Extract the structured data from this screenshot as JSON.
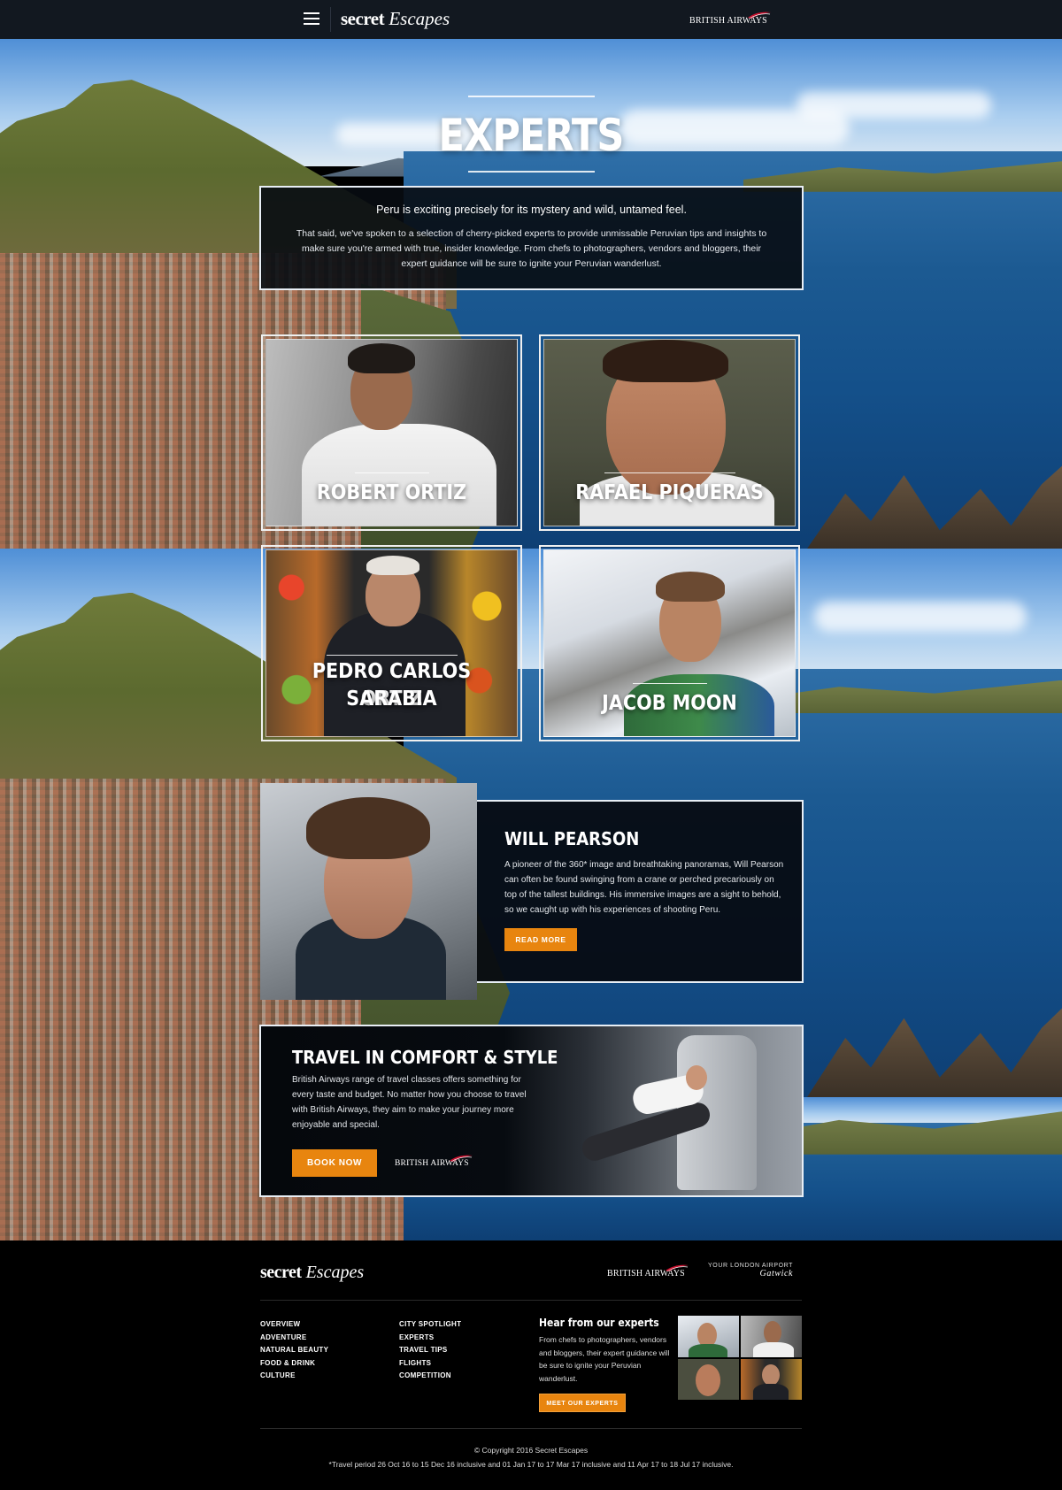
{
  "header": {
    "menu_icon": "hamburger-menu-icon",
    "logo": {
      "part1": "secret",
      "part2": "Escapes"
    },
    "partner_logo": "BRITISH AIRWAYS"
  },
  "hero": {
    "title": "EXPERTS",
    "lead": "Peru is exciting precisely for its mystery and wild, untamed feel.",
    "body": "That said, we've spoken to a selection of cherry-picked experts to provide unmissable Peruvian tips and insights to make sure you're armed with true, insider knowledge. From chefs to photographers, vendors and bloggers, their expert guidance will be sure to ignite your Peruvian wanderlust."
  },
  "experts": [
    {
      "name": "ROBERT ORTIZ"
    },
    {
      "name": "RAFAEL PIQUERAS"
    },
    {
      "name_line1": "PEDRO CARLOS ORTIZ",
      "name_line2": "SARABIA"
    },
    {
      "name": "JACOB MOON"
    }
  ],
  "feature": {
    "name": "WILL PEARSON",
    "text": "A pioneer of the 360* image and breathtaking panoramas, Will Pearson can often be found swinging from a crane or perched precariously on top of the tallest buildings. His immersive images are a sight to behold, so we caught up with his experiences of shooting Peru.",
    "button": "READ MORE"
  },
  "promo": {
    "title": "TRAVEL IN COMFORT & STYLE",
    "text": "British Airways range of travel classes offers something for every taste and budget. No matter how you choose to travel with British Airways, they aim to make your journey more enjoyable and special.",
    "button": "BOOK NOW",
    "logo": "BRITISH AIRWAYS"
  },
  "footer": {
    "logo": {
      "part1": "secret",
      "part2": "Escapes"
    },
    "ba_logo": "BRITISH AIRWAYS",
    "gatwick": {
      "line1": "YOUR LONDON AIRPORT",
      "line2": "Gatwick"
    },
    "nav_col1": [
      "OVERVIEW",
      "ADVENTURE",
      "NATURAL BEAUTY",
      "FOOD & DRINK",
      "CULTURE"
    ],
    "nav_col2": [
      "CITY SPOTLIGHT",
      "EXPERTS",
      "TRAVEL TIPS",
      "FLIGHTS",
      "COMPETITION"
    ],
    "hear_title": "Hear from our experts",
    "hear_text": "From chefs to photographers, vendors and bloggers, their expert guidance will be sure to ignite your Peruvian wanderlust.",
    "hear_button": "MEET OUR EXPERTS",
    "copyright": "© Copyright 2016 Secret Escapes",
    "travel_note": "*Travel period 26 Oct 16 to 15 Dec 16 inclusive and 01 Jan 17 to 17 Mar 17 inclusive and 11 Apr 17 to 18 Jul 17 inclusive."
  },
  "colors": {
    "accent_orange": "#e8850f",
    "nav_bg": "#121820",
    "panel_bg": "#080c12",
    "ba_red": "#c8102e"
  }
}
